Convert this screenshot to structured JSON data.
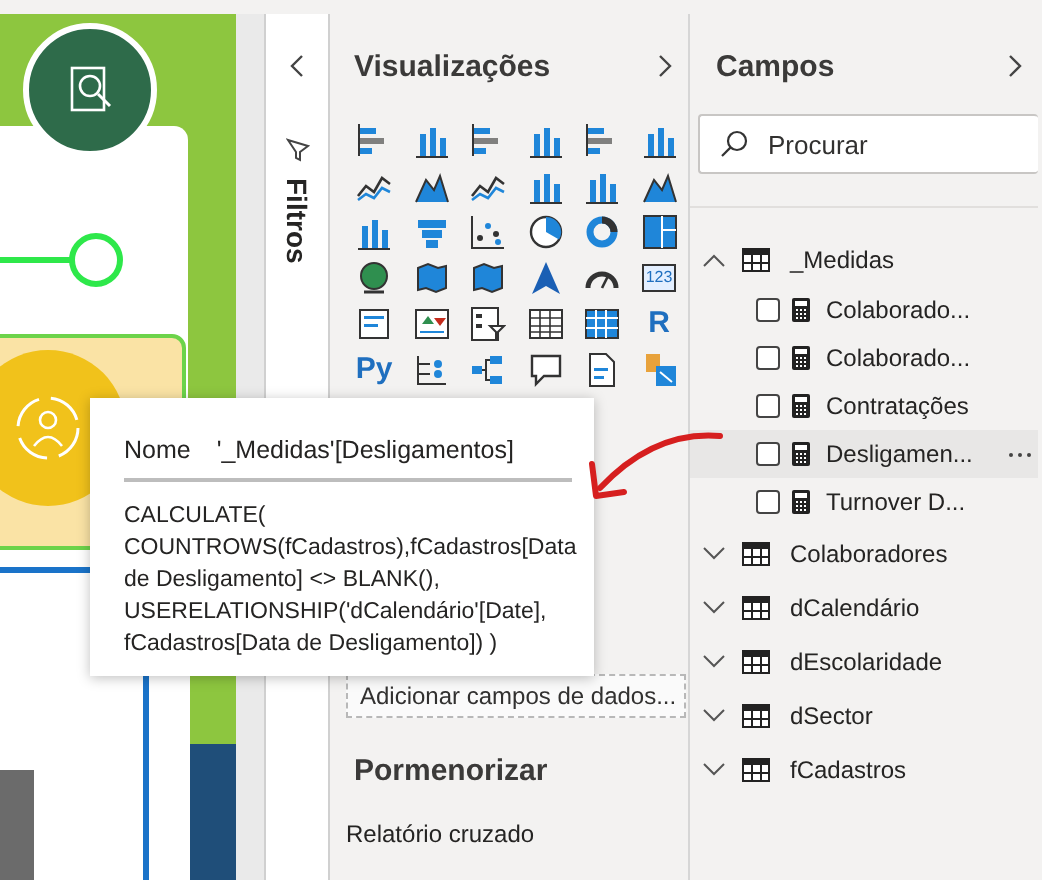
{
  "filters": {
    "title": "Filtros"
  },
  "visualizations": {
    "title": "Visualizações",
    "text_icons": [
      {
        "text": "123"
      },
      {
        "text": "R"
      },
      {
        "text": "Py"
      }
    ],
    "add_fields": {
      "placeholder": "Adicionar campos de dados..."
    },
    "drill_title": "Pormenorizar",
    "cross_report": {
      "label": "Relatório cruzado"
    }
  },
  "fields": {
    "title": "Campos",
    "search": {
      "placeholder": "Procurar"
    },
    "tables": [
      {
        "name": "_Medidas",
        "expanded": true,
        "children": [
          {
            "name": "Colaborado...",
            "checked": false,
            "hovered": false
          },
          {
            "name": "Colaborado...",
            "checked": false,
            "hovered": false
          },
          {
            "name": "Contratações",
            "checked": false,
            "hovered": false
          },
          {
            "name": "Desligamen...",
            "checked": false,
            "hovered": true
          },
          {
            "name": "Turnover D...",
            "checked": false,
            "hovered": false
          }
        ]
      },
      {
        "name": "Colaboradores",
        "expanded": false
      },
      {
        "name": "dCalendário",
        "expanded": false
      },
      {
        "name": "dEscolaridade",
        "expanded": false
      },
      {
        "name": "dSector",
        "expanded": false
      },
      {
        "name": "fCadastros",
        "expanded": false
      }
    ]
  },
  "tooltip": {
    "name_label": "Nome",
    "name_value": "'_Medidas'[Desligamentos]",
    "expression": "CALCULATE(\nCOUNTROWS(fCadastros),fCadastros[Data de Desligamento] <> BLANK(),\nUSERELATIONSHIP('dCalendário'[Date],\nfCadastros[Data de Desligamento]) )"
  }
}
